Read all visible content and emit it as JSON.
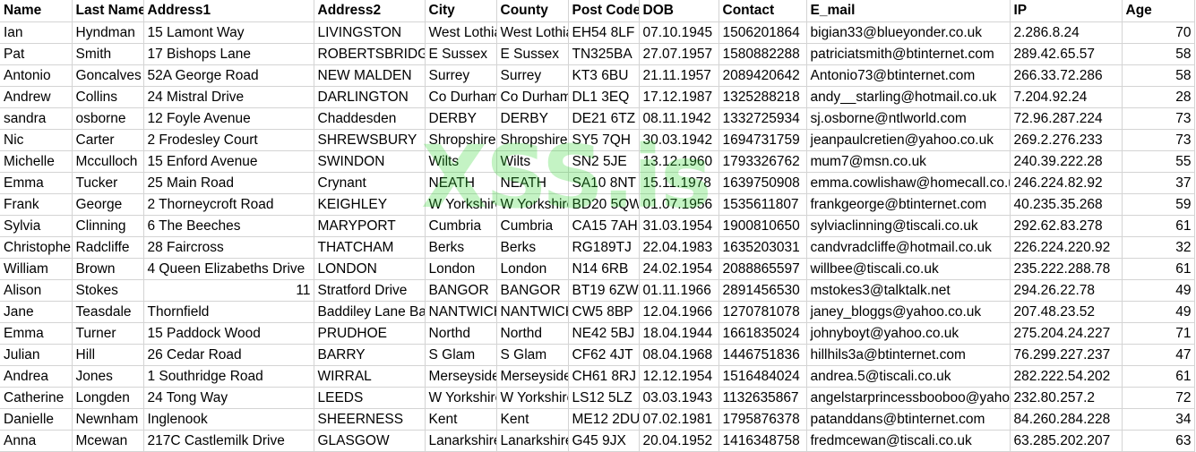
{
  "columns": [
    "Name",
    "Last Name",
    "Address1",
    "Address2",
    "City",
    "County",
    "Post Code",
    "DOB",
    "Contact",
    "E_mail",
    "IP",
    "Age"
  ],
  "watermark": "XSS.is",
  "rows": [
    [
      "Ian",
      "Hyndman",
      "15 Lamont Way",
      "LIVINGSTON",
      "West Lothian",
      "West Lothian",
      "EH54 8LF",
      "07.10.1945",
      "1506201864",
      "bigian33@blueyonder.co.uk",
      "2.286.8.24",
      "70"
    ],
    [
      "Pat",
      "Smith",
      "17 Bishops Lane",
      "ROBERTSBRIDGE",
      "E Sussex",
      "E Sussex",
      "TN325BA",
      "27.07.1957",
      "1580882288",
      "patriciatsmith@btinternet.com",
      "289.42.65.57",
      "58"
    ],
    [
      "Antonio",
      "Goncalves",
      "52A George Road",
      "NEW MALDEN",
      "Surrey",
      "Surrey",
      "KT3 6BU",
      "21.11.1957",
      "2089420642",
      "Antonio73@btinternet.com",
      "266.33.72.286",
      "58"
    ],
    [
      "Andrew",
      "Collins",
      "24 Mistral Drive",
      "DARLINGTON",
      "Co Durham",
      "Co Durham",
      "DL1 3EQ",
      "17.12.1987",
      "1325288218",
      "andy__starling@hotmail.co.uk",
      "7.204.92.24",
      "28"
    ],
    [
      "sandra",
      "osborne",
      "12 Foyle Avenue",
      "Chaddesden",
      "DERBY",
      "DERBY",
      "DE21 6TZ",
      "08.11.1942",
      "1332725934",
      "sj.osborne@ntlworld.com",
      "72.96.287.224",
      "73"
    ],
    [
      "Nic",
      "Carter",
      "2 Frodesley Court",
      "SHREWSBURY",
      "Shropshire",
      "Shropshire",
      "SY5 7QH",
      "30.03.1942",
      "1694731759",
      "jeanpaulcretien@yahoo.co.uk",
      "269.2.276.233",
      "73"
    ],
    [
      "Michelle",
      "Mcculloch",
      "15 Enford Avenue",
      "SWINDON",
      "Wilts",
      "Wilts",
      "SN2 5JE",
      "13.12.1960",
      "1793326762",
      "mum7@msn.co.uk",
      "240.39.222.28",
      "55"
    ],
    [
      "Emma",
      "Tucker",
      "25 Main Road",
      "Crynant",
      "NEATH",
      "NEATH",
      "SA10 8NT",
      "15.11.1978",
      "1639750908",
      "emma.cowlishaw@homecall.co.uk",
      "246.224.82.92",
      "37"
    ],
    [
      "Frank",
      "George",
      "2 Thorneycroft Road",
      "KEIGHLEY",
      "W Yorkshire",
      "W Yorkshire",
      "BD20 5QW",
      "01.07.1956",
      "1535611807",
      "frankgeorge@btinternet.com",
      "40.235.35.268",
      "59"
    ],
    [
      "Sylvia",
      "Clinning",
      "6 The Beeches",
      "MARYPORT",
      "Cumbria",
      "Cumbria",
      "CA15 7AH",
      "31.03.1954",
      "1900810650",
      "sylviaclinning@tiscali.co.uk",
      "292.62.83.278",
      "61"
    ],
    [
      "Christopher",
      "Radcliffe",
      "28 Faircross",
      "THATCHAM",
      "Berks",
      "Berks",
      "RG189TJ",
      "22.04.1983",
      "1635203031",
      "candvradcliffe@hotmail.co.uk",
      "226.224.220.92",
      "32"
    ],
    [
      "William",
      "Brown",
      "4 Queen Elizabeths Drive",
      "LONDON",
      "London",
      "London",
      "N14 6RB",
      "24.02.1954",
      "2088865597",
      "willbee@tiscali.co.uk",
      "235.222.288.78",
      "61"
    ],
    [
      "Alison",
      "Stokes",
      "11",
      "Stratford Drive",
      "BANGOR",
      "BANGOR",
      "BT19 6ZW",
      "01.11.1966",
      "2891456530",
      "mstokes3@talktalk.net",
      "294.26.22.78",
      "49"
    ],
    [
      "Jane",
      "Teasdale",
      "Thornfield",
      "Baddiley Lane Baddiley",
      "NANTWICH",
      "NANTWICH",
      "CW5 8BP",
      "12.04.1966",
      "1270781078",
      "janey_bloggs@yahoo.co.uk",
      "207.48.23.52",
      "49"
    ],
    [
      "Emma",
      "Turner",
      "15 Paddock Wood",
      "PRUDHOE",
      "Northd",
      "Northd",
      "NE42 5BJ",
      "18.04.1944",
      "1661835024",
      "johnyboyt@yahoo.co.uk",
      "275.204.24.227",
      "71"
    ],
    [
      "Julian",
      "Hill",
      "26 Cedar Road",
      "BARRY",
      "S Glam",
      "S Glam",
      "CF62 4JT",
      "08.04.1968",
      "1446751836",
      "hillhils3a@btinternet.com",
      "76.299.227.237",
      "47"
    ],
    [
      "Andrea",
      "Jones",
      "1 Southridge Road",
      "WIRRAL",
      "Merseyside",
      "Merseyside",
      "CH61 8RJ",
      "12.12.1954",
      "1516484024",
      "andrea.5@tiscali.co.uk",
      "282.222.54.202",
      "61"
    ],
    [
      "Catherine",
      "Longden",
      "24 Tong Way",
      "LEEDS",
      "W Yorkshire",
      "W Yorkshire",
      "LS12 5LZ",
      "03.03.1943",
      "1132635867",
      "angelstarprincessbooboo@yahoo.co.uk",
      "232.80.257.2",
      "72"
    ],
    [
      "Danielle",
      "Newnham",
      "Inglenook",
      "SHEERNESS",
      "Kent",
      "Kent",
      "ME12 2DU",
      "07.02.1981",
      "1795876378",
      "patanddans@btinternet.com",
      "84.260.284.228",
      "34"
    ],
    [
      "Anna",
      "Mcewan",
      "217C Castlemilk Drive",
      "GLASGOW",
      "Lanarkshire",
      "Lanarkshire",
      "G45 9JX",
      "20.04.1952",
      "1416348758",
      "fredmcewan@tiscali.co.uk",
      "63.285.202.207",
      "63"
    ]
  ]
}
